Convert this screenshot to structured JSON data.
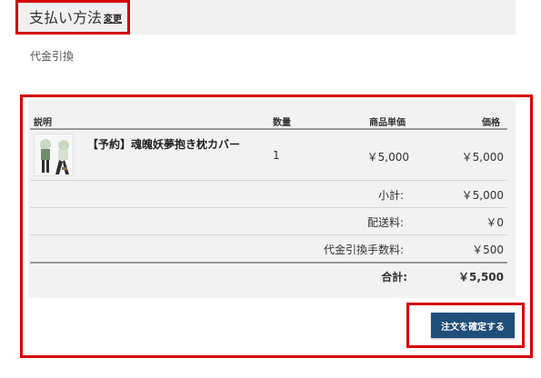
{
  "payment": {
    "title": "支払い方法",
    "change_label": "変更",
    "method": "代金引換"
  },
  "table": {
    "headers": {
      "description": "説明",
      "quantity": "数量",
      "unit_price": "商品単価",
      "price": "価格"
    },
    "item": {
      "name": "【予約】魂魄妖夢抱き枕カバー",
      "quantity": "1",
      "unit_price": "￥5,000",
      "price": "￥5,000"
    },
    "summary": {
      "subtotal_label": "小計:",
      "subtotal_value": "￥5,000",
      "shipping_label": "配送料:",
      "shipping_value": "￥0",
      "cod_fee_label": "代金引換手数料:",
      "cod_fee_value": "￥500",
      "total_label": "合計:",
      "total_value": "￥5,500"
    }
  },
  "actions": {
    "confirm_label": "注文を確定する"
  },
  "colors": {
    "highlight": "#d40000",
    "button_bg": "#1f4e79",
    "panel_bg": "#f2f2f2"
  },
  "icons": {
    "product_thumbnail": "product-image"
  }
}
